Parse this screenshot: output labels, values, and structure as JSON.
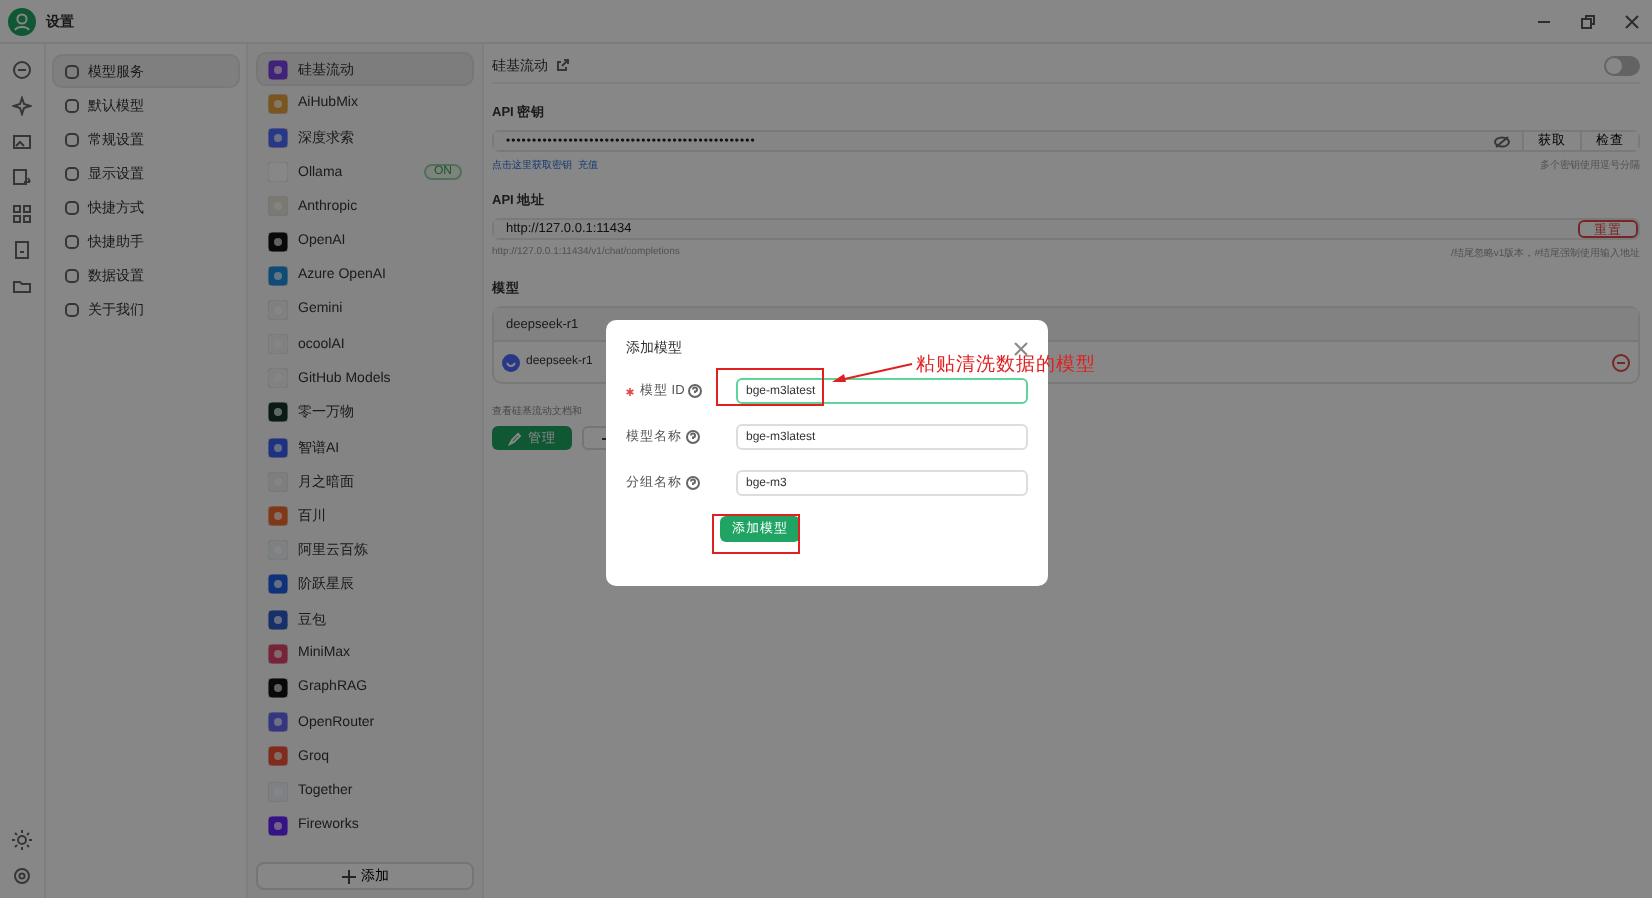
{
  "window": {
    "title": "设置"
  },
  "menu": [
    {
      "label": "模型服务",
      "selected": true
    },
    {
      "label": "默认模型",
      "selected": false
    },
    {
      "label": "常规设置",
      "selected": false
    },
    {
      "label": "显示设置",
      "selected": false
    },
    {
      "label": "快捷方式",
      "selected": false
    },
    {
      "label": "快捷助手",
      "selected": false
    },
    {
      "label": "数据设置",
      "selected": false
    },
    {
      "label": "关于我们",
      "selected": false
    }
  ],
  "providers": [
    {
      "name": "硅基流动",
      "selected": true
    },
    {
      "name": "AiHubMix",
      "selected": false
    },
    {
      "name": "深度求索",
      "selected": false
    },
    {
      "name": "Ollama",
      "selected": false,
      "badge": "ON"
    },
    {
      "name": "Anthropic",
      "selected": false
    },
    {
      "name": "OpenAI",
      "selected": false
    },
    {
      "name": "Azure OpenAI",
      "selected": false
    },
    {
      "name": "Gemini",
      "selected": false
    },
    {
      "name": "ocoolAI",
      "selected": false
    },
    {
      "name": "GitHub Models",
      "selected": false
    },
    {
      "name": "零一万物",
      "selected": false
    },
    {
      "name": "智谱AI",
      "selected": false
    },
    {
      "name": "月之暗面",
      "selected": false
    },
    {
      "name": "百川",
      "selected": false
    },
    {
      "name": "阿里云百炼",
      "selected": false
    },
    {
      "name": "阶跃星辰",
      "selected": false
    },
    {
      "name": "豆包",
      "selected": false
    },
    {
      "name": "MiniMax",
      "selected": false
    },
    {
      "name": "GraphRAG",
      "selected": false
    },
    {
      "name": "OpenRouter",
      "selected": false
    },
    {
      "name": "Groq",
      "selected": false
    },
    {
      "name": "Together",
      "selected": false
    },
    {
      "name": "Fireworks",
      "selected": false
    }
  ],
  "add_provider": "添加",
  "detail": {
    "title": "硅基流动",
    "enabled": false,
    "api_key": {
      "label": "API 密钥",
      "value": "••••••••••••••••••••••••••••••••••••••••••••••••",
      "buttons": [
        "获取",
        "检查"
      ],
      "links": [
        "点击这里获取密钥",
        "充值"
      ],
      "hint": "多个密钥使用逗号分隔"
    },
    "api_host": {
      "label": "API 地址",
      "value": "http://127.0.0.1:11434",
      "reset": "重置",
      "preview": "http://127.0.0.1:11434/v1/chat/completions",
      "hint": "/结尾忽略v1版本，#结尾强制使用输入地址"
    },
    "models": {
      "label": "模型",
      "groups": [
        {
          "name": "deepseek-r1",
          "models": [
            "deepseek-r1"
          ]
        }
      ],
      "note": "查看硅基流动文档和",
      "manage": "管理"
    }
  },
  "modal": {
    "title": "添加模型",
    "fields": [
      {
        "label": "模型 ID",
        "required": true,
        "value": "bge-m3latest",
        "focused": true
      },
      {
        "label": "模型名称",
        "required": false,
        "value": "bge-m3latest",
        "focused": false
      },
      {
        "label": "分组名称",
        "required": false,
        "value": "bge-m3",
        "focused": false
      }
    ],
    "submit": "添加模型"
  },
  "annotation": {
    "text": "粘贴清洗数据的模型"
  }
}
